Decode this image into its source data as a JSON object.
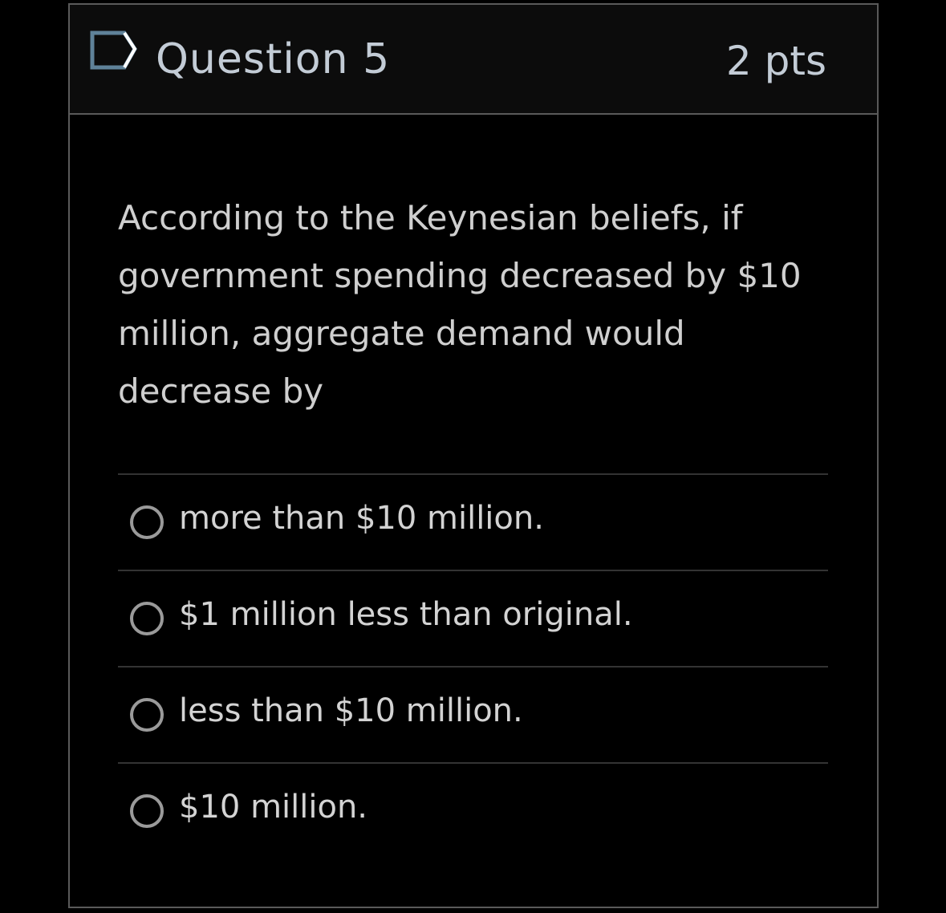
{
  "question": {
    "title": "Question 5",
    "points": "2 pts",
    "flag_icon": "flag-outline-icon",
    "text": "According to the Keynesian beliefs, if government spending decreased by $10 million, aggregate demand would decrease by"
  },
  "answers": [
    {
      "label": "more than $10 million."
    },
    {
      "label": "$1 million less than original."
    },
    {
      "label": "less than $10 million."
    },
    {
      "label": "$10 million."
    }
  ],
  "colors": {
    "background": "#000000",
    "header_background": "#0c0c0c",
    "border": "#5a5a5a",
    "title_text": "#c3ccd6",
    "flag_icon": "#5f8299"
  }
}
